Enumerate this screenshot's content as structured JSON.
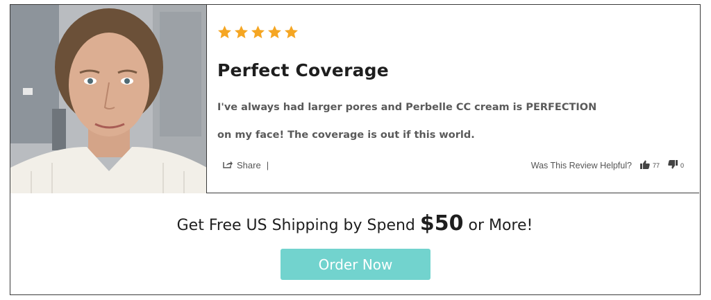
{
  "review": {
    "rating": 5,
    "max_rating": 5,
    "star_color": "#f5a623",
    "title": "Perfect Coverage",
    "body_line1": "I've always had larger pores and Perbelle CC cream is PERFECTION",
    "body_line2": "on my face! The coverage is out if this world.",
    "share_label": "Share",
    "separator": "|",
    "helpful_label": "Was This Review Helpful?",
    "upvotes": "77",
    "downvotes": "0"
  },
  "promo": {
    "text_before": "Get Free US Shipping by Spend ",
    "amount": "$50",
    "text_after": " or More!"
  },
  "cta": {
    "label": "Order Now",
    "color": "#72d3ce"
  },
  "icons": {
    "star": "star-icon",
    "share": "share-icon",
    "thumbs_up": "thumbs-up-icon",
    "thumbs_down": "thumbs-down-icon"
  }
}
